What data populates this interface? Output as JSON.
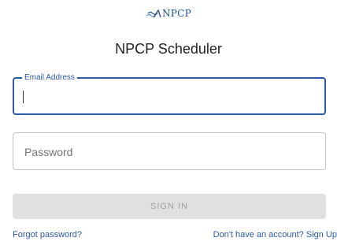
{
  "logo": {
    "text": "NPCP",
    "icon": "npcp-logo-wave-icon",
    "color": "#1f4f8a"
  },
  "title": "NPCP Scheduler",
  "email": {
    "label": "Email Address",
    "value": ""
  },
  "password": {
    "placeholder": "Password",
    "value": ""
  },
  "signin_label": "SIGN IN",
  "links": {
    "forgot": "Forgot password?",
    "signup": "Don't have an account? Sign Up"
  },
  "colors": {
    "accent": "#2b5aa6",
    "button_disabled_bg": "#e0e0e0",
    "button_disabled_text": "#a0a0a0"
  }
}
